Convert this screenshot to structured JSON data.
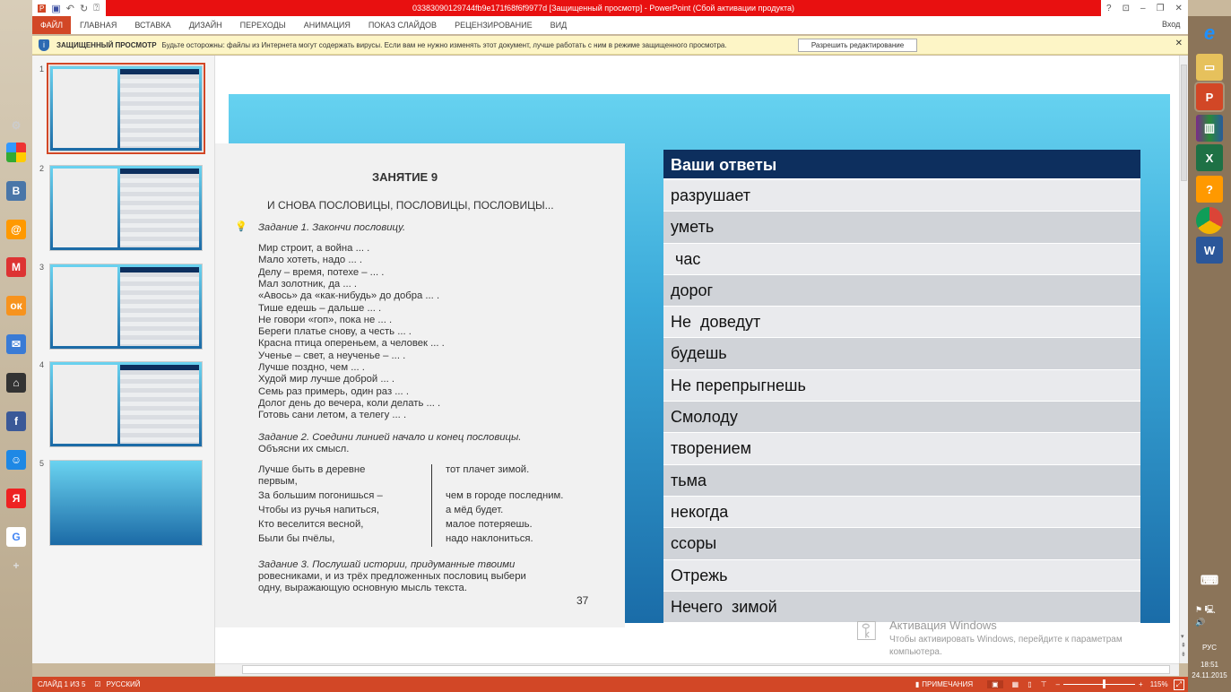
{
  "window": {
    "title": "03383090129744fb9e171f68f6f9977d [Защищенный просмотр] -  PowerPoint (Сбой активации продукта)",
    "help": "?",
    "signin": "Вход"
  },
  "ribbon_tabs": [
    "ФАЙЛ",
    "ГЛАВНАЯ",
    "ВСТАВКА",
    "ДИЗАЙН",
    "ПЕРЕХОДЫ",
    "АНИМАЦИЯ",
    "ПОКАЗ СЛАЙДОВ",
    "РЕЦЕНЗИРОВАНИЕ",
    "ВИД"
  ],
  "protected_view": {
    "title": "ЗАЩИЩЕННЫЙ ПРОСМОТР",
    "message": "Будьте осторожны: файлы из Интернета могут содержать вирусы. Если вам не нужно изменять этот документ, лучше работать с ним в режиме защищенного просмотра.",
    "button": "Разрешить редактирование"
  },
  "thumbnails": [
    "1",
    "2",
    "3",
    "4",
    "5"
  ],
  "page": {
    "heading": "ЗАНЯТИЕ 9",
    "subheading": "И СНОВА ПОСЛОВИЦЫ, ПОСЛОВИЦЫ, ПОСЛОВИЦЫ...",
    "task1": "Задание 1. Закончи пословицу.",
    "proverbs": [
      "Мир строит, а война ... .",
      "Мало хотеть, надо ... .",
      "Делу – время, потехе – ... .",
      "Мал золотник, да ... .",
      "«Авось» да «как-нибудь» до добра ... .",
      "Тише едешь – дальше ... .",
      "Не говори «гоп», пока не ... .",
      "Береги платье снову, а честь ... .",
      "Красна птица опереньем, а человек ... .",
      "Ученье – свет, а неученье – ... .",
      "Лучше поздно, чем ... .",
      "Худой мир лучше доброй ... .",
      "Семь раз примерь, один раз ... .",
      "Долог день до вечера, коли делать ... .",
      "Готовь сани летом, а телегу ... ."
    ],
    "task2": "Задание 2. Соедини линией начало и конец пословицы.",
    "task2b": "Объясни их смысл.",
    "left": [
      "Лучше быть в деревне",
      "первым,",
      "За большим погонишься –",
      "Чтобы из ручья напиться,",
      "Кто веселится весной,",
      "Были бы пчёлы,"
    ],
    "right": [
      "тот плачет зимой.",
      "чем в городе последним.",
      "а мёд будет.",
      "малое потеряешь.",
      "надо наклониться."
    ],
    "task3": [
      "Задание 3. Послушай истории, придуманные твоими",
      "ровесниками, и из трёх предложенных пословиц выбери",
      "одну, выражающую основную мысль текста."
    ],
    "page_number": "37"
  },
  "answers": {
    "header": "Ваши ответы",
    "rows": [
      "разрушает",
      "уметь",
      " час",
      "дорог",
      "Не  доведут",
      "будешь",
      "Не перепрыгнешь",
      "Смолоду",
      "творением",
      "тьма",
      "некогда",
      "ссоры",
      "Отрежь",
      "Нечего  зимой"
    ]
  },
  "watermark": {
    "title": "Активация Windows",
    "text1": "Чтобы активировать Windows, перейдите к параметрам",
    "text2": "компьютера."
  },
  "status": {
    "slide": "СЛАЙД 1 ИЗ 5",
    "language": "РУССКИЙ",
    "notes": "ПРИМЕЧАНИЯ",
    "zoom": "115%",
    "zoom_fraction": 0.55
  },
  "tray": {
    "lang": "РУС",
    "time": "18:51",
    "date": "24.11.2015"
  }
}
